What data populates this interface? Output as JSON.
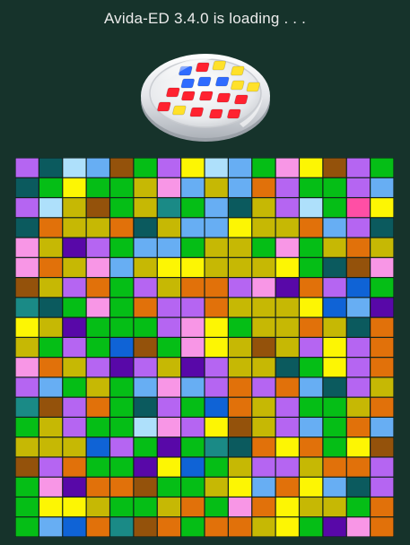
{
  "app": {
    "loading_text": "Avida-ED 3.4.0 is loading . . ."
  },
  "icons": {
    "petri_dish": "petri-dish-icon"
  },
  "palette": {
    "background": "#16332b",
    "cell_border": "#0f1f1a",
    "colors": {
      "P": "#b565f2",
      "T": "#0b5a5e",
      "L": "#aee0fb",
      "B": "#67aef3",
      "W": "#94520b",
      "G": "#05be16",
      "Y": "#fdf603",
      "O": "#e1710a",
      "M": "#c6b804",
      "K": "#f896e6",
      "R": "#ff4fa5",
      "N": "#5808a8",
      "D": "#0f63d6",
      "C": "#1a8a86"
    }
  },
  "grid": {
    "rows": [
      "PTLBWGPYLBGKYWPG",
      "TGYGGMKBMBOPGGPB",
      "PLMWGMCGBTMPLGRY",
      "TOMMOTMBBYMMOBPT",
      "KMNPGBBGMMGKGMOM",
      "KOMKBMYYMMMYGTWK",
      "WMPOGPMOOPKNOPDG",
      "CTGKGOPPOMMMYDBN",
      "YMNGGGPKYGMMOMTO",
      "MGPGDWGKYMWMPYPO",
      "KOMPNPMNPMMTGYPO",
      "PBGMGBKBPOPOBTPM",
      "CWPOGTPGDOMPGGMO",
      "GMPGGLKPYWMPBGOB",
      "MMMDPGNGCTOYOGYW",
      "WPOGGNYDGMPPMOOP",
      "GKNOOWGGMYBOYBTP",
      "GYYMGGMOGKOYMMGO",
      "GBDOCWOGOOMYGNKO"
    ]
  }
}
